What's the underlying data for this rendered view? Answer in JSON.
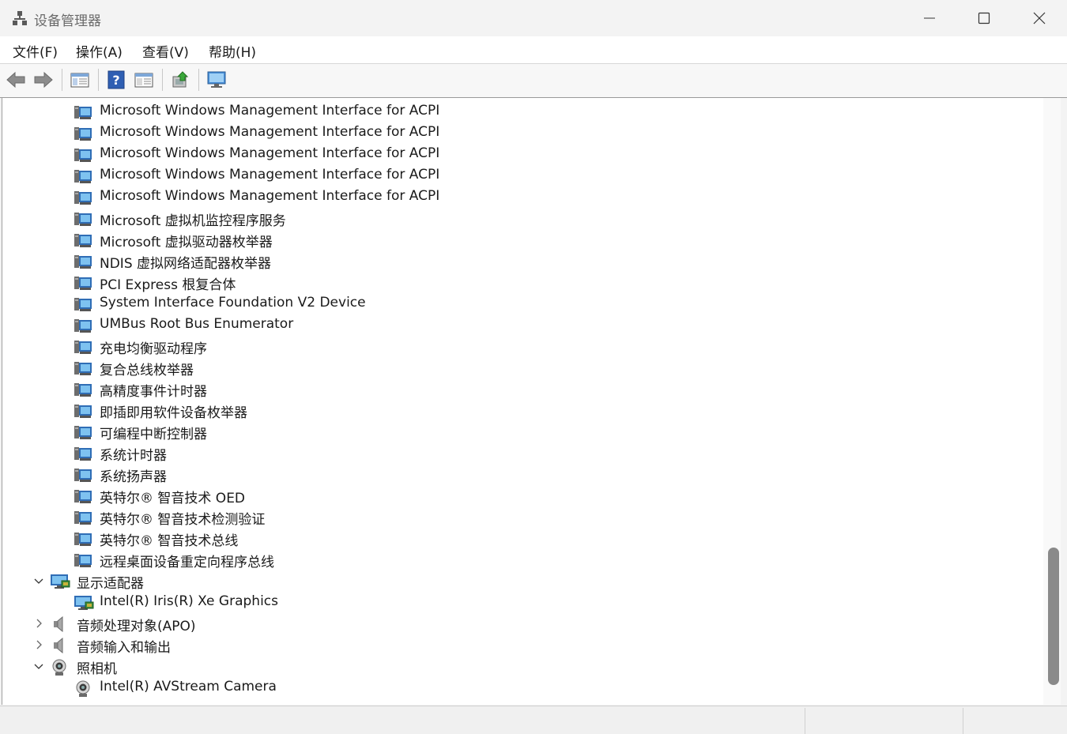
{
  "window": {
    "title": "设备管理器",
    "controls": [
      "minimize-icon",
      "maximize-icon",
      "close-icon"
    ]
  },
  "menu": {
    "items": [
      "文件(F)",
      "操作(A)",
      "查看(V)",
      "帮助(H)"
    ]
  },
  "toolbar": {
    "buttons": [
      "back-arrow-icon",
      "forward-arrow-icon",
      "show-hide-console-tree-icon",
      "help-icon",
      "properties-icon",
      "update-driver-icon",
      "monitor-icon"
    ]
  },
  "tree": {
    "system_children": [
      "Microsoft Windows Management Interface for ACPI",
      "Microsoft Windows Management Interface for ACPI",
      "Microsoft Windows Management Interface for ACPI",
      "Microsoft Windows Management Interface for ACPI",
      "Microsoft Windows Management Interface for ACPI",
      "Microsoft 虚拟机监控程序服务",
      "Microsoft 虚拟驱动器枚举器",
      "NDIS 虚拟网络适配器枚举器",
      "PCI Express 根复合体",
      "System Interface Foundation V2 Device",
      "UMBus Root Bus Enumerator",
      "充电均衡驱动程序",
      "复合总线枚举器",
      "高精度事件计时器",
      "即插即用软件设备枚举器",
      "可编程中断控制器",
      "系统计时器",
      "系统扬声器",
      "英特尔® 智音技术 OED",
      "英特尔® 智音技术检测验证",
      "英特尔® 智音技术总线",
      "远程桌面设备重定向程序总线"
    ],
    "display_adapters": {
      "label": "显示适配器",
      "state": "expanded",
      "children": [
        "Intel(R) Iris(R) Xe Graphics"
      ]
    },
    "audio_processing": {
      "label": "音频处理对象(APO)",
      "state": "collapsed"
    },
    "audio_io": {
      "label": "音频输入和输出",
      "state": "collapsed"
    },
    "cameras": {
      "label": "照相机",
      "state": "expanded",
      "children": [
        "Intel(R) AVStream Camera"
      ]
    }
  }
}
